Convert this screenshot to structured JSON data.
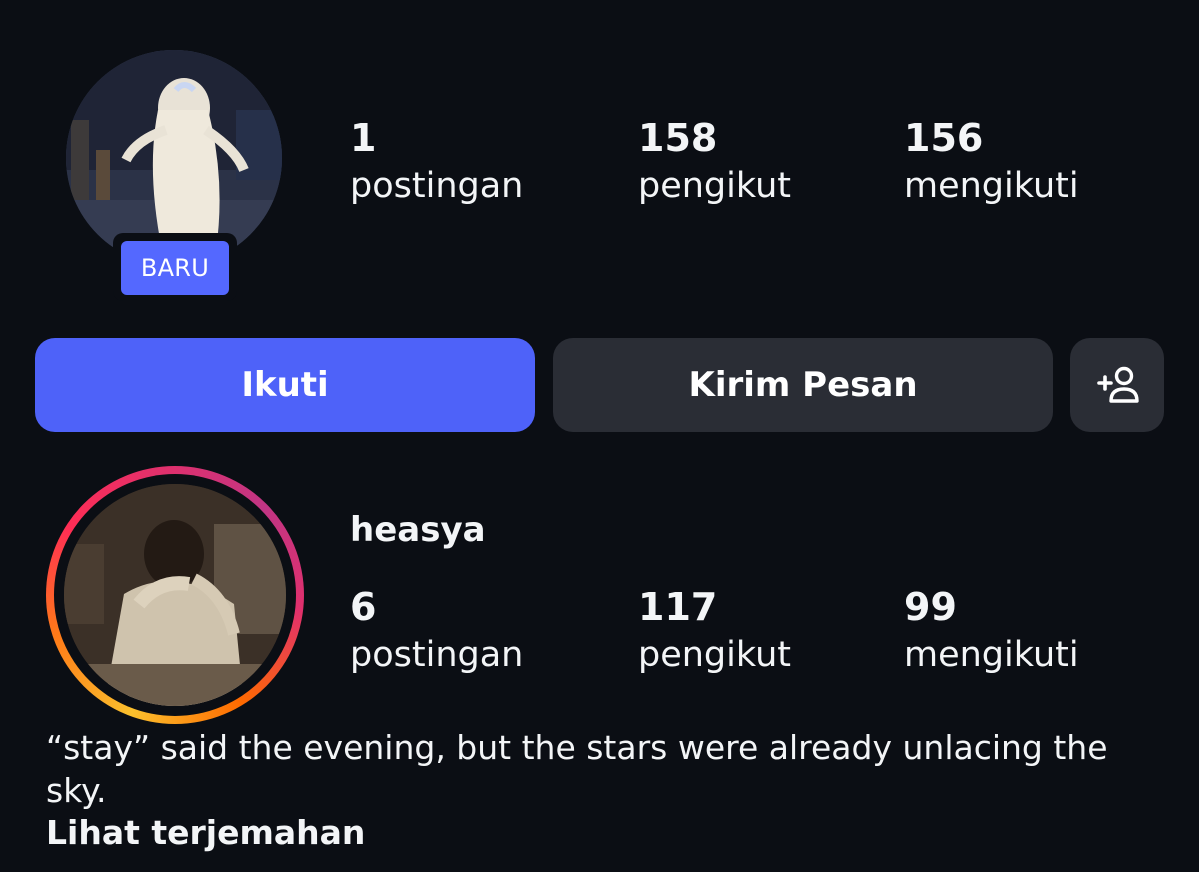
{
  "profile_top": {
    "badge": "BARU",
    "stats": {
      "posts": {
        "value": "1",
        "label": "postingan"
      },
      "followers": {
        "value": "158",
        "label": "pengikut"
      },
      "following": {
        "value": "156",
        "label": "mengikuti"
      }
    }
  },
  "actions": {
    "follow_label": "Ikuti",
    "message_label": "Kirim Pesan",
    "add_user_icon": "add-user-icon"
  },
  "profile_second": {
    "username": "heasya",
    "stats": {
      "posts": {
        "value": "6",
        "label": "postingan"
      },
      "followers": {
        "value": "117",
        "label": "pengikut"
      },
      "following": {
        "value": "99",
        "label": "mengikuti"
      }
    },
    "bio": "“stay” said the evening, but the stars were already unlacing the sky.",
    "translate_label": "Lihat terjemahan"
  },
  "colors": {
    "background": "#0b0e14",
    "accent": "#4e62f9",
    "secondary_button": "#2a2d35",
    "text": "#f3f5f7"
  }
}
